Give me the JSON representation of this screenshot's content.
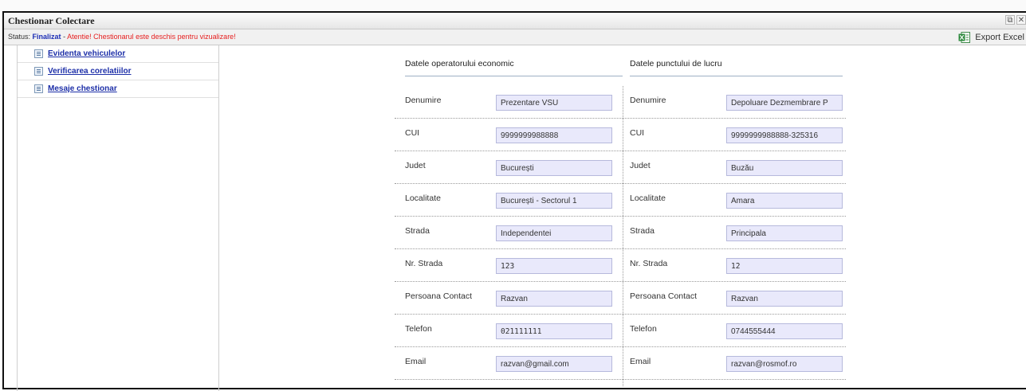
{
  "window": {
    "title": "Chestionar Colectare",
    "restore_icon": "restore-icon",
    "close_icon": "close-icon"
  },
  "statusbar": {
    "label": "Status:",
    "value": "Finalizat",
    "separator": "-",
    "warning": "Atentie! Chestionarul este deschis pentru vizualizare!",
    "export_label": "Export Excel",
    "export_icon": "excel-icon"
  },
  "sidebar": {
    "items": [
      {
        "label": "Evidenta vehiculelor",
        "icon": "document-icon"
      },
      {
        "label": "Verificarea corelatiilor",
        "icon": "document-icon"
      },
      {
        "label": "Mesaje chestionar",
        "icon": "document-icon"
      }
    ]
  },
  "form": {
    "operator_header": "Datele operatorului economic",
    "workpoint_header": "Datele punctului de lucru",
    "rows": [
      {
        "label": "Denumire",
        "operator_value": "Prezentare VSU",
        "workpoint_label": "Denumire",
        "workpoint_value": "Depoluare Dezmembrare P"
      },
      {
        "label": "CUI",
        "operator_value": "9999999988888",
        "workpoint_label": "CUI",
        "workpoint_value": "9999999988888-325316"
      },
      {
        "label": "Judet",
        "operator_value": "București",
        "workpoint_label": "Judet",
        "workpoint_value": "Buzău"
      },
      {
        "label": "Localitate",
        "operator_value": "București - Sectorul 1",
        "workpoint_label": "Localitate",
        "workpoint_value": "Amara"
      },
      {
        "label": "Strada",
        "operator_value": "Independentei",
        "workpoint_label": "Strada",
        "workpoint_value": "Principala"
      },
      {
        "label": "Nr. Strada",
        "operator_value": "123",
        "workpoint_label": "Nr. Strada",
        "workpoint_value": "12"
      },
      {
        "label": "Persoana Contact",
        "operator_value": "Razvan",
        "workpoint_label": "Persoana Contact",
        "workpoint_value": "Razvan"
      },
      {
        "label": "Telefon",
        "operator_value": "021111111",
        "workpoint_label": "Telefon",
        "workpoint_value": "0744555444"
      },
      {
        "label": "Email",
        "operator_value": "razvan@gmail.com",
        "workpoint_label": "Email",
        "workpoint_value": "razvan@rosmof.ro"
      }
    ]
  },
  "colors": {
    "status_value": "#1d2fb5",
    "warning": "#e62020",
    "link": "#1d2fa8",
    "field_bg": "#e9e9fb"
  }
}
